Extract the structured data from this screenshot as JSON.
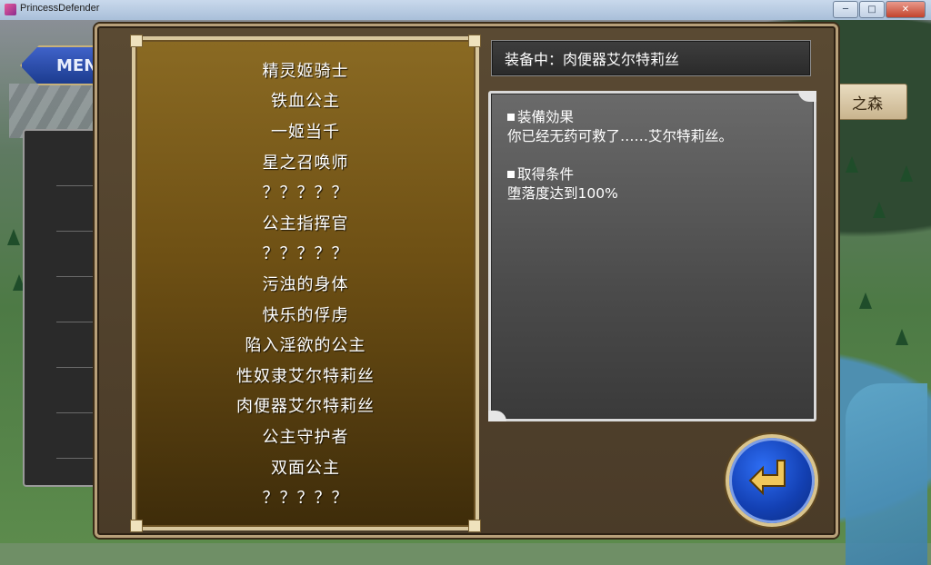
{
  "window": {
    "title": "PrincessDefender"
  },
  "window_buttons": {
    "minimize": "─",
    "maximize": "□",
    "close": "✕"
  },
  "background": {
    "menu_label": "MENU",
    "location_sign": "之森"
  },
  "title_list": {
    "items": [
      "精灵姬骑士",
      "铁血公主",
      "一姬当千",
      "星之召唤师",
      "？？？？？",
      "公主指挥官",
      "？？？？？",
      "污浊的身体",
      "快乐的俘虏",
      "陷入淫欲的公主",
      "性奴隶艾尔特莉丝",
      "肉便器艾尔特莉丝",
      "公主守护者",
      "双面公主",
      "？？？？？"
    ]
  },
  "equipped": {
    "label": "装备中：肉便器艾尔特莉丝"
  },
  "description": {
    "effect_heading": "装備効果",
    "effect_text": "你已经无药可救了……艾尔特莉丝。",
    "condition_heading": "取得条件",
    "condition_text": "堕落度达到100%"
  },
  "colors": {
    "accent_gold": "#d8c79e",
    "button_blue": "#1340b3"
  },
  "icons": {
    "return": "return-arrow-icon"
  }
}
